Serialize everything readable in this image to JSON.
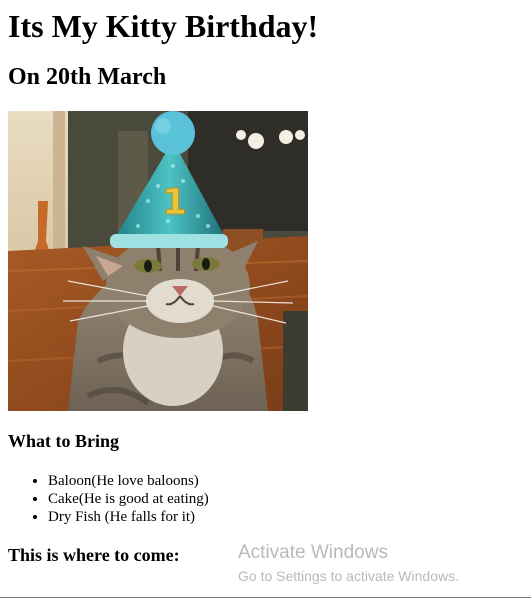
{
  "page": {
    "title": "Its My Kitty Birthday!",
    "subtitle": "On 20th March",
    "image_subject": "cat-in-party-hat",
    "hat_number": "1",
    "bring_heading": "What to Bring",
    "bring_items": [
      "Baloon(He love baloons)",
      "Cake(He is good at eating)",
      "Dry Fish (He falls for it)"
    ],
    "where_heading": "This is where to come:"
  },
  "watermark": {
    "title": "Activate Windows",
    "subtitle": "Go to Settings to activate Windows."
  },
  "colors": {
    "background": "#ffffff",
    "text": "#000000",
    "watermark": "#b9b9b9"
  }
}
